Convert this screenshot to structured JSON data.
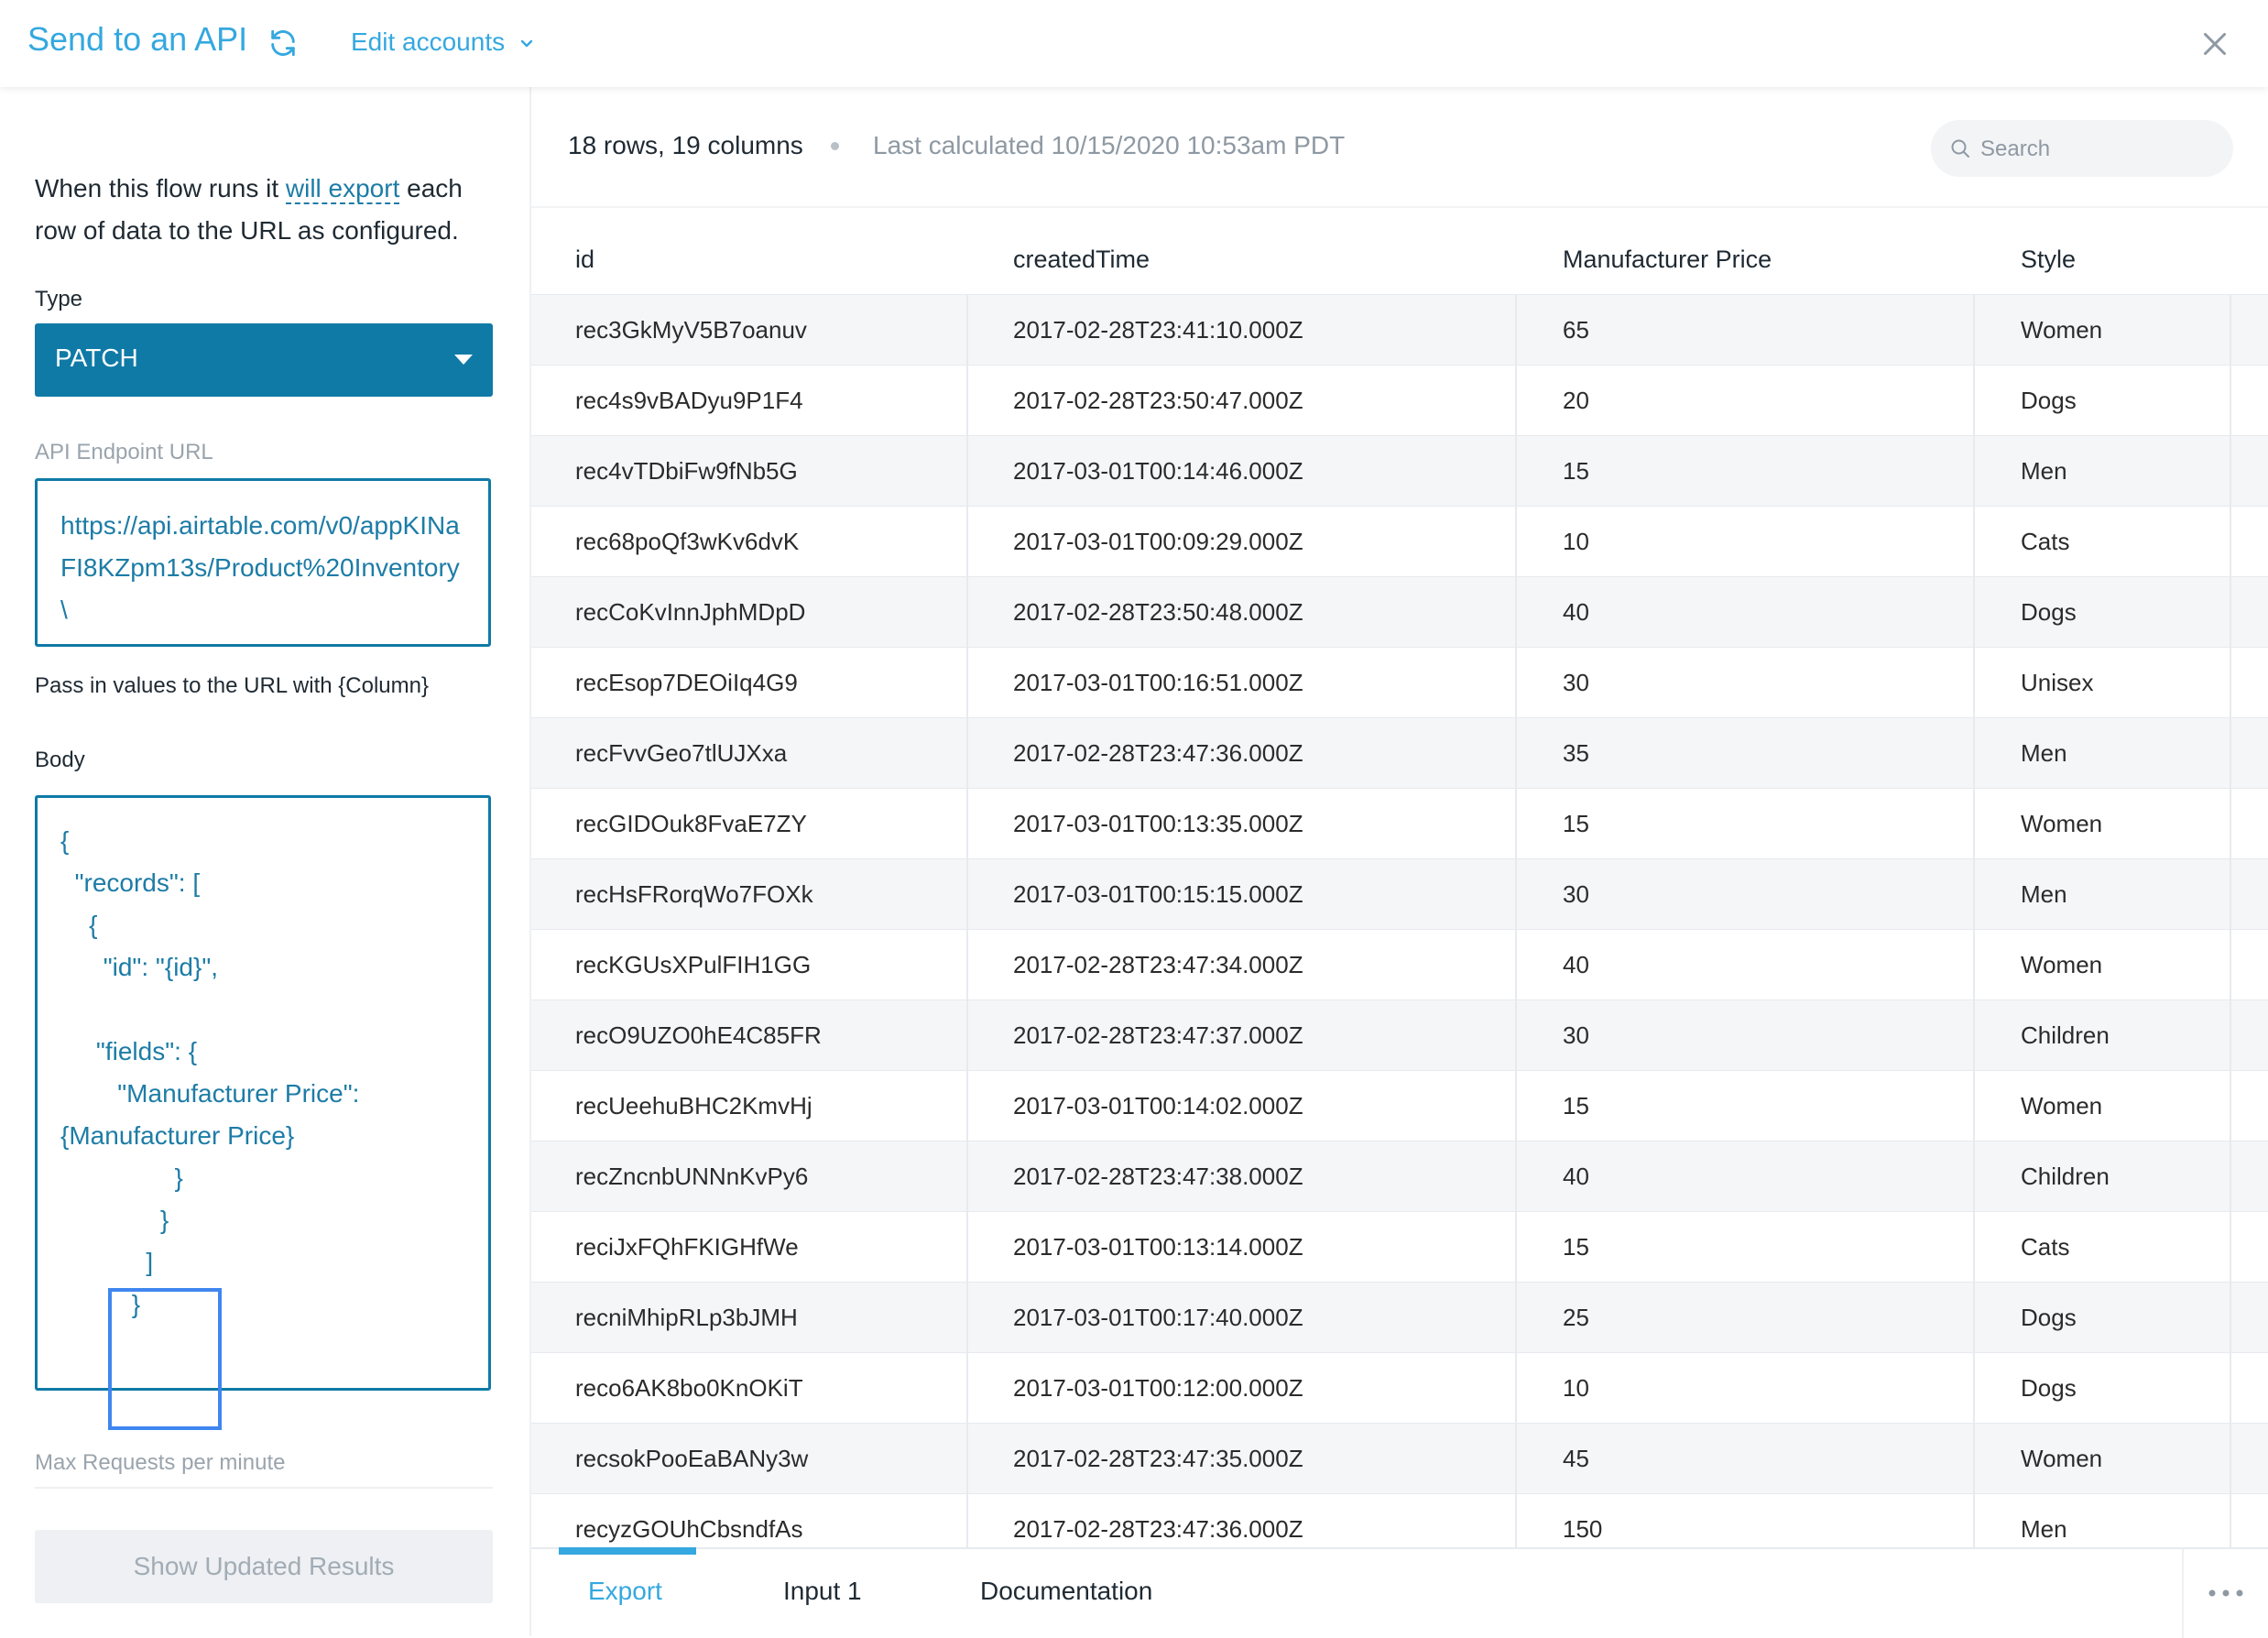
{
  "header": {
    "title": "Send to an API",
    "edit_accounts_label": "Edit accounts"
  },
  "left_panel": {
    "intro_before": "When this flow runs it ",
    "intro_link": "will export",
    "intro_after": " each row of data to the URL as configured.",
    "type_label": "Type",
    "type_value": "PATCH",
    "endpoint_label": "API Endpoint URL",
    "endpoint_value": "https://api.airtable.com/v0/appKINaFI8KZpm13s/Product%20Inventory \\",
    "endpoint_hint": "Pass in values to the URL with {Column}",
    "body_label": "Body",
    "body_value": "{\n  \"records\": [\n    {\n      \"id\": \"{id}\",\n\n     \"fields\": {\n        \"Manufacturer Price\": {Manufacturer Price}\n                }\n              }\n            ]\n          }",
    "max_requests_label": "Max Requests per minute",
    "show_results_label": "Show Updated Results"
  },
  "data_panel": {
    "row_count": "18 rows, 19 columns",
    "last_calculated": "Last calculated 10/15/2020 10:53am PDT",
    "search_placeholder": "Search",
    "columns": [
      "id",
      "createdTime",
      "Manufacturer Price",
      "Style"
    ],
    "rows": [
      [
        "rec3GkMyV5B7oanuv",
        "2017-02-28T23:41:10.000Z",
        "65",
        "Women"
      ],
      [
        "rec4s9vBADyu9P1F4",
        "2017-02-28T23:50:47.000Z",
        "20",
        "Dogs"
      ],
      [
        "rec4vTDbiFw9fNb5G",
        "2017-03-01T00:14:46.000Z",
        "15",
        "Men"
      ],
      [
        "rec68poQf3wKv6dvK",
        "2017-03-01T00:09:29.000Z",
        "10",
        "Cats"
      ],
      [
        "recCoKvInnJphMDpD",
        "2017-02-28T23:50:48.000Z",
        "40",
        "Dogs"
      ],
      [
        "recEsop7DEOiIq4G9",
        "2017-03-01T00:16:51.000Z",
        "30",
        "Unisex"
      ],
      [
        "recFvvGeo7tlUJXxa",
        "2017-02-28T23:47:36.000Z",
        "35",
        "Men"
      ],
      [
        "recGIDOuk8FvaE7ZY",
        "2017-03-01T00:13:35.000Z",
        "15",
        "Women"
      ],
      [
        "recHsFRorqWo7FOXk",
        "2017-03-01T00:15:15.000Z",
        "30",
        "Men"
      ],
      [
        "recKGUsXPulFIH1GG",
        "2017-02-28T23:47:34.000Z",
        "40",
        "Women"
      ],
      [
        "recO9UZO0hE4C85FR",
        "2017-02-28T23:47:37.000Z",
        "30",
        "Children"
      ],
      [
        "recUeehuBHC2KmvHj",
        "2017-03-01T00:14:02.000Z",
        "15",
        "Women"
      ],
      [
        "recZncnbUNNnKvPy6",
        "2017-02-28T23:47:38.000Z",
        "40",
        "Children"
      ],
      [
        "reciJxFQhFKIGHfWe",
        "2017-03-01T00:13:14.000Z",
        "15",
        "Cats"
      ],
      [
        "recniMhipRLp3bJMH",
        "2017-03-01T00:17:40.000Z",
        "25",
        "Dogs"
      ],
      [
        "reco6AK8bo0KnOKiT",
        "2017-03-01T00:12:00.000Z",
        "10",
        "Dogs"
      ],
      [
        "recsokPooEaBANy3w",
        "2017-02-28T23:47:35.000Z",
        "45",
        "Women"
      ],
      [
        "recyzGOUhCbsndfAs",
        "2017-02-28T23:47:36.000Z",
        "150",
        "Men"
      ]
    ],
    "tabs": [
      "Export",
      "Input 1",
      "Documentation"
    ],
    "active_tab": "Export"
  },
  "colors": {
    "accent": "#35a8df",
    "primary": "#0f7aa6",
    "highlight": "#3f86f0"
  },
  "icons": [
    "refresh-icon",
    "chevron-down-icon",
    "close-icon",
    "search-icon",
    "more-icon"
  ]
}
